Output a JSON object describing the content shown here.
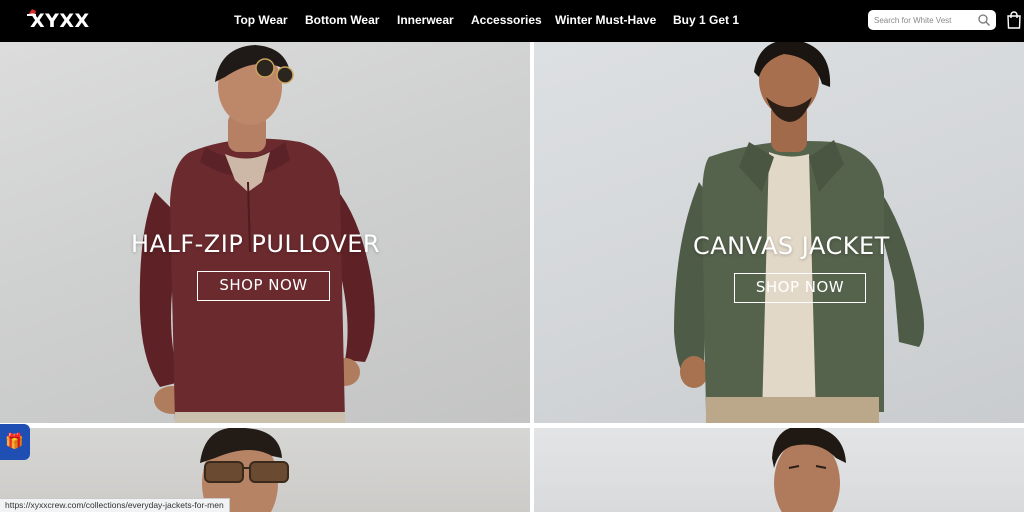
{
  "header": {
    "logo": "XYXX",
    "nav": [
      {
        "label": "Top Wear"
      },
      {
        "label": "Bottom Wear"
      },
      {
        "label": "Innerwear"
      },
      {
        "label": "Accessories"
      },
      {
        "label": "Winter Must-Have"
      },
      {
        "label": "Buy 1 Get 1"
      }
    ],
    "search": {
      "placeholder": "Search for White Vest",
      "value": ""
    },
    "icons": {
      "search": "search-icon",
      "cart": "shopping-bag-icon",
      "logo_hat": "santa-hat-icon"
    }
  },
  "banners": [
    {
      "title": "HALF-ZIP PULLOVER",
      "button": "SHOP NOW"
    },
    {
      "title": "CANVAS JACKET",
      "button": "SHOP NOW"
    }
  ],
  "floating": {
    "gift_icon": "gift-icon"
  },
  "status_bar": {
    "url": "https://xyxxcrew.com/collections/everyday-jackets-for-men"
  },
  "colors": {
    "header_bg": "#000000",
    "gift_bg": "#1f4fb3",
    "pullover": "#6b2a2e",
    "jacket": "#55624c"
  }
}
